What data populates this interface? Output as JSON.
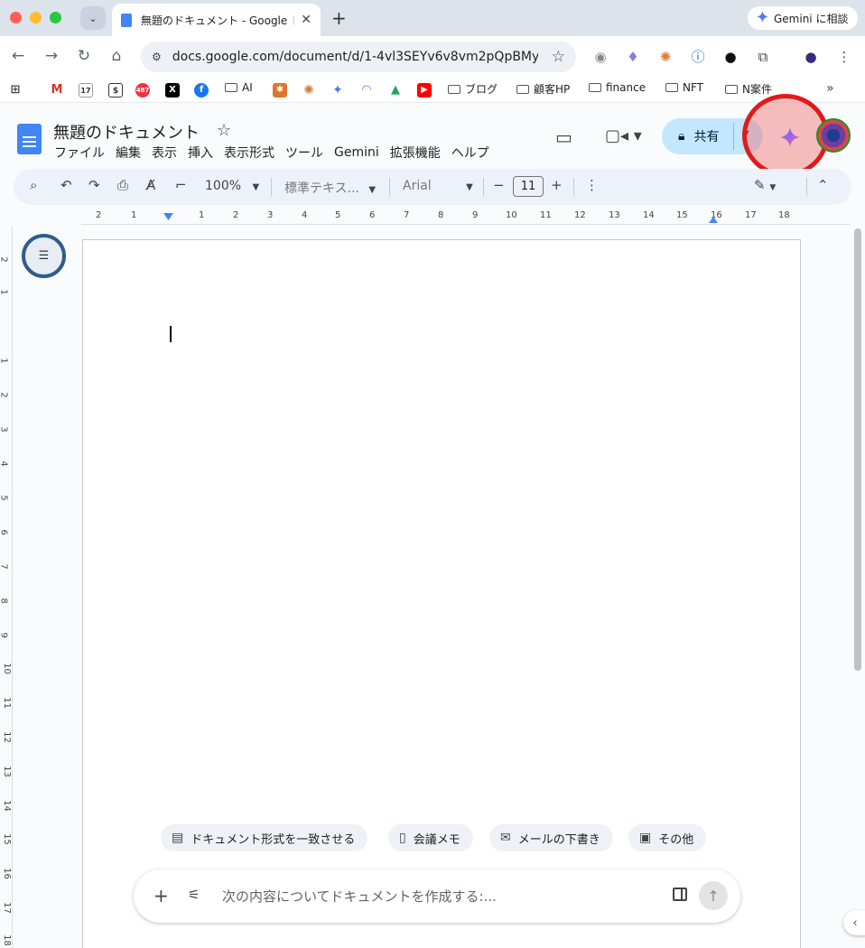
{
  "browser": {
    "tab_title": "無題のドキュメント - Google ドキュメント",
    "gemini_consult_label": "Gemini に相談",
    "url": "docs.google.com/document/d/1-4vl3SEYv6v8vm2pQpBMy...",
    "bookmarks": {
      "ai": "AI",
      "blog": "ブログ",
      "customer_hp": "顧客HP",
      "finance": "finance",
      "nft": "NFT",
      "n_project": "N案件",
      "calendar_badge": "17",
      "notification_badge": "487"
    }
  },
  "docs": {
    "title": "無題のドキュメント",
    "menu": [
      "ファイル",
      "編集",
      "表示",
      "挿入",
      "表示形式",
      "ツール",
      "Gemini",
      "拡張機能",
      "ヘルプ"
    ],
    "share_label": "共有"
  },
  "toolbar": {
    "zoom": "100%",
    "style": "標準テキス...",
    "font": "Arial",
    "font_size": "11"
  },
  "ruler": {
    "h_ticks": [
      "2",
      "1",
      "1",
      "2",
      "3",
      "4",
      "5",
      "6",
      "7",
      "8",
      "9",
      "10",
      "11",
      "12",
      "13",
      "14",
      "15",
      "16",
      "17",
      "18"
    ],
    "v_ticks": [
      "2",
      "1",
      "1",
      "2",
      "3",
      "4",
      "5",
      "6",
      "7",
      "8",
      "9",
      "10",
      "11",
      "12",
      "13",
      "14",
      "15",
      "16",
      "17",
      "18"
    ]
  },
  "chips": {
    "match_format": "ドキュメント形式を一致させる",
    "meeting_notes": "会議メモ",
    "email_draft": "メールの下書き",
    "more": "その他"
  },
  "prompt": {
    "placeholder": "次の内容についてドキュメントを作成する:..."
  },
  "colors": {
    "accent": "#4285f4",
    "share_bg": "#c2e7ff",
    "highlight": "#e0191b"
  }
}
